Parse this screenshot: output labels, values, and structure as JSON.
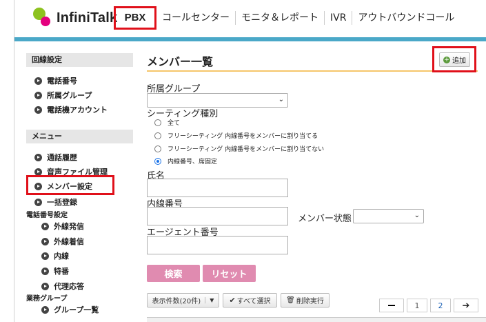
{
  "header": {
    "logo_text": "InfiniTalk",
    "nav": [
      "PBX",
      "コールセンター",
      "モニタ＆レポート",
      "IVR",
      "アウトバウンドコール"
    ]
  },
  "sidebar": {
    "section1": "回線設定",
    "section1_items": [
      "電話番号",
      "所属グループ",
      "電話機アカウント"
    ],
    "section2": "メニュー",
    "menu_items": [
      "通話履歴",
      "音声ファイル管理",
      "メンバー設定",
      "一括登録"
    ],
    "group_phone": "電話番号設定",
    "phone_items": [
      "外線発信",
      "外線着信",
      "内線",
      "特番",
      "代理応答"
    ],
    "group_business": "業務グループ",
    "business_items": [
      "グループ一覧"
    ]
  },
  "main": {
    "title": "メンバー一覧",
    "add_label": "追加",
    "group_label": "所属グループ",
    "group_value": "",
    "seating_label": "シーティング種別",
    "radios": [
      "全て",
      "フリーシーティング 内線番号をメンバーに割り当てる",
      "フリーシーティング 内線番号をメンバーに割り当てない",
      "内線番号、席固定"
    ],
    "selected_radio": 3,
    "name_label": "氏名",
    "ext_label": "内線番号",
    "status_label": "メンバー状態",
    "agent_label": "エージェント番号",
    "search_label": "検索",
    "reset_label": "リセット",
    "per_page_label": "表示件数(20件)",
    "select_all_label": "すべて選択",
    "delete_label": "削除実行",
    "pages": [
      "1",
      "2"
    ]
  },
  "colors": {
    "accent_bar": "#4aa8c8",
    "highlight": "#e0101a",
    "button_pink": "#e08bb0",
    "title_underline": "#f5c66a"
  }
}
